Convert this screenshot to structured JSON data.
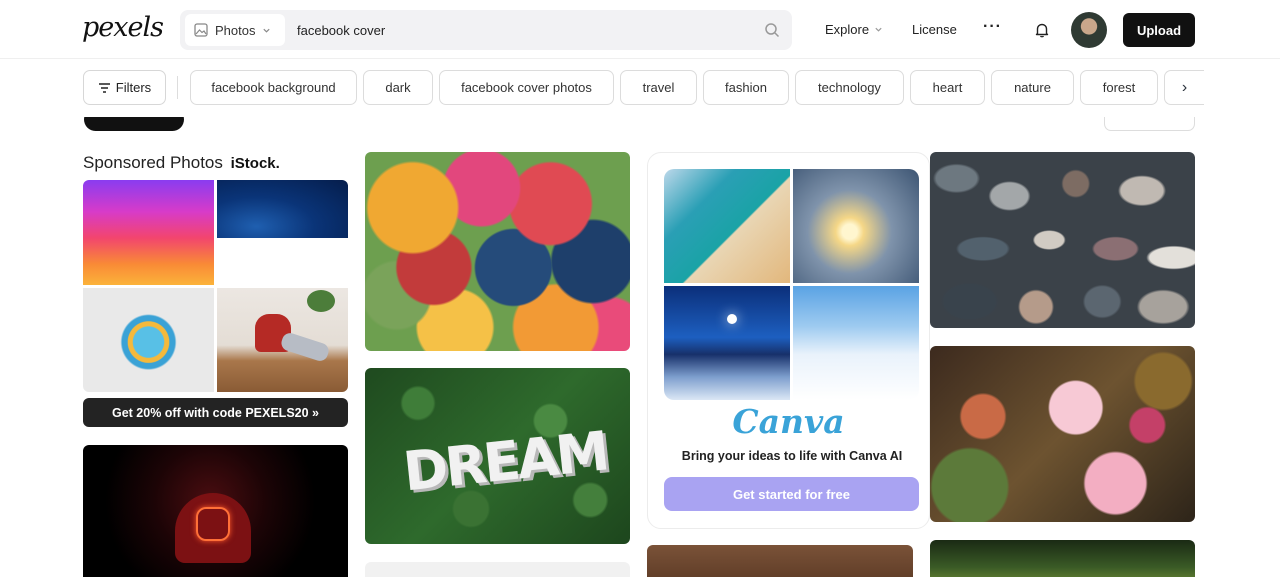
{
  "header": {
    "logo": "pexels",
    "search_type": "Photos",
    "search_value": "facebook cover",
    "explore": "Explore",
    "license": "License",
    "more": "···",
    "upload": "Upload"
  },
  "chips": {
    "filters": "Filters",
    "items": [
      "facebook background",
      "dark",
      "facebook cover photos",
      "travel",
      "fashion",
      "technology",
      "heart",
      "nature",
      "forest"
    ],
    "next": "›"
  },
  "sponsored": {
    "title": "Sponsored Photos",
    "brand": "iStock.",
    "cta": "Get 20% off with code PEXELS20 »"
  },
  "canva": {
    "logo": "Canva",
    "subtitle": "Bring your ideas to life with Canva AI",
    "button": "Get started for free"
  },
  "icons": {
    "image_type": "image-icon",
    "search": "search-icon",
    "bell": "bell-icon",
    "filters": "filters-icon",
    "chevron": "chevron-down-icon"
  },
  "colors": {
    "primary_dark": "#111111",
    "canva_button": "#a9a3f2",
    "canva_logo": "#3aa3d8"
  }
}
